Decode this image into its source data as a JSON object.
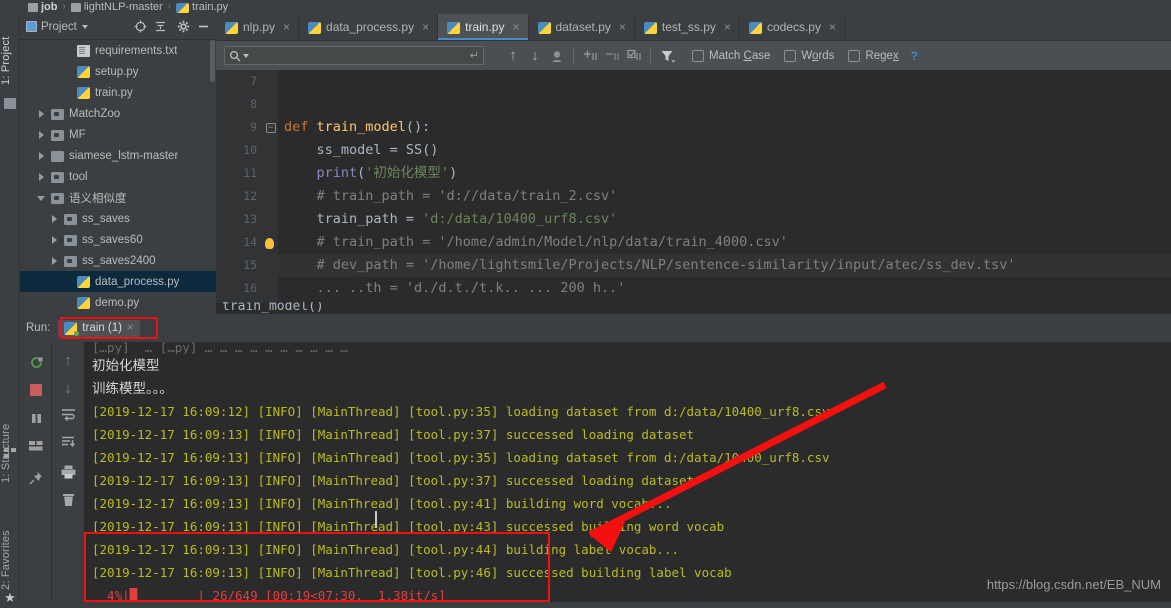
{
  "breadcrumb": {
    "items": [
      {
        "label": "job",
        "icon": "folder-icon",
        "bold": true
      },
      {
        "label": "lightNLP-master",
        "icon": "folder-icon",
        "bold": false
      },
      {
        "label": "train.py",
        "icon": "python-file-icon",
        "bold": false
      }
    ],
    "separator": "›"
  },
  "left_rail": {
    "top_label": "1: Project",
    "structure_label": "1: Structure",
    "favorites_label": "2: Favorites",
    "structure_icon": "structure-icon",
    "favorites_icon": "star-icon",
    "project_icon": "folder-icon"
  },
  "project_panel": {
    "title": "Project",
    "title_caret": "chevron-down-icon",
    "buttons": [
      {
        "name": "locate-icon",
        "glyph": "⊕"
      },
      {
        "name": "collapse-all-icon",
        "glyph": "⤓"
      },
      {
        "name": "gear-icon",
        "glyph": "⚙"
      },
      {
        "name": "hide-icon",
        "glyph": "─"
      }
    ],
    "tree": [
      {
        "label": "requirements.txt",
        "icon": "text-file-icon",
        "indent": 3,
        "twist": "none",
        "selected": false
      },
      {
        "label": "setup.py",
        "icon": "python-file-icon",
        "indent": 3,
        "twist": "none",
        "selected": false
      },
      {
        "label": "train.py",
        "icon": "python-file-icon",
        "indent": 3,
        "twist": "none",
        "selected": false
      },
      {
        "label": "MatchZoo",
        "icon": "source-folder-icon",
        "indent": 1,
        "twist": "closed",
        "selected": false
      },
      {
        "label": "MF",
        "icon": "source-folder-icon",
        "indent": 1,
        "twist": "closed",
        "selected": false
      },
      {
        "label": "siamese_lstm-master",
        "icon": "folder-icon",
        "indent": 1,
        "twist": "closed",
        "selected": false
      },
      {
        "label": "tool",
        "icon": "source-folder-icon",
        "indent": 1,
        "twist": "closed",
        "selected": false
      },
      {
        "label": "语义相似度",
        "icon": "source-folder-icon",
        "indent": 1,
        "twist": "open",
        "selected": false
      },
      {
        "label": "ss_saves",
        "icon": "source-folder-icon",
        "indent": 2,
        "twist": "closed",
        "selected": false
      },
      {
        "label": "ss_saves60",
        "icon": "source-folder-icon",
        "indent": 2,
        "twist": "closed",
        "selected": false
      },
      {
        "label": "ss_saves2400",
        "icon": "source-folder-icon",
        "indent": 2,
        "twist": "closed",
        "selected": false
      },
      {
        "label": "data_process.py",
        "icon": "python-file-icon",
        "indent": 3,
        "twist": "none",
        "selected": true
      },
      {
        "label": "demo.py",
        "icon": "python-file-icon",
        "indent": 3,
        "twist": "none",
        "selected": false
      }
    ]
  },
  "editor_tabs": [
    {
      "label": "nlp.py",
      "icon": "python-file-icon",
      "active": false,
      "close": "×"
    },
    {
      "label": "data_process.py",
      "icon": "python-file-icon",
      "active": false,
      "close": "×"
    },
    {
      "label": "train.py",
      "icon": "python-file-icon",
      "active": true,
      "close": "×"
    },
    {
      "label": "dataset.py",
      "icon": "python-file-icon",
      "active": false,
      "close": "×"
    },
    {
      "label": "test_ss.py",
      "icon": "python-file-icon",
      "active": false,
      "close": "×"
    },
    {
      "label": "codecs.py",
      "icon": "python-file-icon",
      "active": false,
      "close": "×"
    }
  ],
  "find_toolbar": {
    "search_value": "",
    "search_placeholder": "",
    "search_icon": "search-icon",
    "search_caret": "chevron-down-icon",
    "enter_hint": "↵",
    "buttons": [
      {
        "name": "find-previous-icon",
        "glyph": "↑"
      },
      {
        "name": "find-next-icon",
        "glyph": "↓"
      },
      {
        "name": "select-all-occurrences-icon",
        "glyph": "⬤"
      },
      {
        "name": "add-selection-icon",
        "glyph": "+"
      },
      {
        "name": "remove-selection-icon",
        "glyph": "−"
      },
      {
        "name": "select-all-icon",
        "glyph": "☑"
      },
      {
        "name": "filter-icon",
        "glyph": "᎒"
      }
    ],
    "match_case": {
      "label_pre": "Match ",
      "label_u": "C",
      "label_post": "ase",
      "checked": false
    },
    "words": {
      "label_pre": "W",
      "label_u": "o",
      "label_post": "rds",
      "checked": false
    },
    "regex": {
      "label_pre": "Rege",
      "label_u": "x",
      "label_post": "",
      "checked": false
    },
    "help": "?"
  },
  "editor": {
    "line_numbers": [
      "7",
      "8",
      "9",
      "10",
      "11",
      "12",
      "13",
      "14",
      "15",
      "16"
    ],
    "lines": [
      {
        "num": "7",
        "parts": [
          {
            "t": "",
            "c": "pl"
          }
        ]
      },
      {
        "num": "8",
        "parts": [
          {
            "t": "",
            "c": "pl"
          }
        ]
      },
      {
        "num": "9",
        "parts": [
          {
            "t": "def ",
            "c": "kw"
          },
          {
            "t": "train_model",
            "c": "fn"
          },
          {
            "t": "():",
            "c": "pl"
          }
        ]
      },
      {
        "num": "10",
        "parts": [
          {
            "t": "    ss_model = SS()",
            "c": "pl"
          }
        ]
      },
      {
        "num": "11",
        "parts": [
          {
            "t": "    ",
            "c": "pl"
          },
          {
            "t": "print",
            "c": "bi"
          },
          {
            "t": "(",
            "c": "pl"
          },
          {
            "t": "'初始化模型'",
            "c": "str"
          },
          {
            "t": ")",
            "c": "pl"
          }
        ]
      },
      {
        "num": "12",
        "parts": [
          {
            "t": "    # train_path = 'd://data/train_2.csv'",
            "c": "cmt"
          }
        ]
      },
      {
        "num": "13",
        "parts": [
          {
            "t": "    train_path = ",
            "c": "pl"
          },
          {
            "t": "'d:/data/10400_urf8.csv'",
            "c": "str"
          }
        ]
      },
      {
        "num": "14",
        "parts": [
          {
            "t": "    # train_path = '/home/admin/Model/nlp/data/train_4000.csv'",
            "c": "cmt"
          }
        ]
      },
      {
        "num": "15",
        "parts": [
          {
            "t": "    # dev_path = '/home/lightsmile/Projects/NLP/sentence-similarity/input/atec/ss_dev.tsv'",
            "c": "cmt"
          }
        ]
      },
      {
        "num": "16",
        "parts": [
          {
            "t": "    ... ..th = 'd./d.t./t.k.. ... 200 h..'",
            "c": "cmt"
          }
        ]
      }
    ],
    "partial_bottom_line": "train_model()"
  },
  "run_window": {
    "run_label": "Run:",
    "tab_label": "train (1)",
    "tab_icon": "python-run-icon",
    "tab_close": "×",
    "toolbar_left": [
      {
        "name": "rerun-icon",
        "glyph": "↻",
        "color": "#5a9f4a"
      },
      {
        "name": "stop-icon",
        "glyph": "■",
        "color": "#cd5c5c"
      },
      {
        "name": "pause-icon",
        "glyph": "⎉",
        "color": "#a0a0a0"
      },
      {
        "name": "layout-icon",
        "glyph": "▦",
        "color": "#a0a0a0"
      },
      {
        "name": "pin-icon",
        "glyph": "⚲",
        "color": "#a0a0a0"
      }
    ],
    "toolbar_right": [
      {
        "name": "scroll-up-icon",
        "glyph": "↑"
      },
      {
        "name": "scroll-down-icon",
        "glyph": "↓"
      },
      {
        "name": "soft-wrap-icon",
        "glyph": "↵"
      },
      {
        "name": "scroll-to-end-icon",
        "glyph": "⬇"
      },
      {
        "name": "print-icon",
        "glyph": "⎙"
      },
      {
        "name": "trash-icon",
        "glyph": "Ὕ1"
      }
    ],
    "console_lines": [
      {
        "text": "[…py]  … […py] … … … … … … … … … …",
        "type": "clipped"
      },
      {
        "text": "初始化模型",
        "type": "zh"
      },
      {
        "text": "训练模型。。。",
        "type": "zh"
      },
      {
        "text": "[2019-12-17 16:09:12] [INFO] [MainThread] [tool.py:35] loading dataset from d:/data/10400_urf8.csv",
        "type": "log"
      },
      {
        "text": "[2019-12-17 16:09:13] [INFO] [MainThread] [tool.py:37] successed loading dataset",
        "type": "log"
      },
      {
        "text": "[2019-12-17 16:09:13] [INFO] [MainThread] [tool.py:35] loading dataset from d:/data/10400_urf8.csv",
        "type": "log"
      },
      {
        "text": "[2019-12-17 16:09:13] [INFO] [MainThread] [tool.py:37] successed loading dataset",
        "type": "log"
      },
      {
        "text": "[2019-12-17 16:09:13] [INFO] [MainThread] [tool.py:41] building word vocab...",
        "type": "log"
      },
      {
        "text": "[2019-12-17 16:09:13] [INFO] [MainThread] [tool.py:43] successed building word vocab",
        "type": "log"
      },
      {
        "text": "[2019-12-17 16:09:13] [INFO] [MainThread] [tool.py:44] building label vocab...",
        "type": "log"
      },
      {
        "text": "[2019-12-17 16:09:13] [INFO] [MainThread] [tool.py:46] successed building label vocab",
        "type": "log"
      }
    ],
    "progress_line": {
      "percent": "  4%|",
      "bar_filled": "█",
      "bar_empty": "        ",
      "bar_end": "| ",
      "counter": "26/649 ",
      "timing": "[00:19<07:30,  1.38it/s]"
    }
  },
  "annotations": {
    "highlight_color": "#f10f0f",
    "arrow_color": "#f50f0f"
  },
  "watermark": {
    "text": "https://blog.csdn.net/EB_NUM"
  }
}
